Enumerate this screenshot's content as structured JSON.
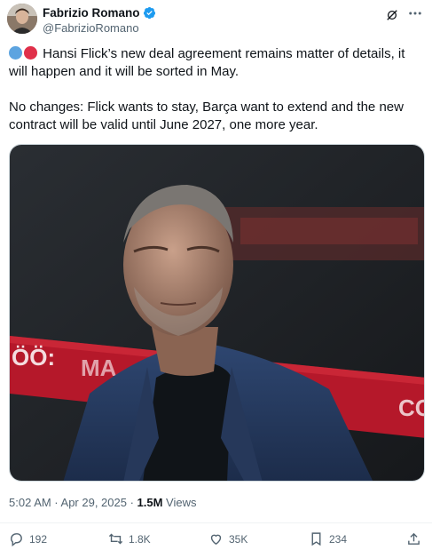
{
  "author": {
    "name": "Fabrizio Romano",
    "handle": "@FabrizioRomano"
  },
  "tweet": {
    "paragraph1": "Hansi Flick’s new deal agreement remains matter of details, it will happen and it will be sorted in May.",
    "paragraph2": "No changes: Flick wants to stay, Barça want to extend and the new contract will be valid until June 2027, one more year."
  },
  "media": {
    "banner_left": "ÖÖ:",
    "banner_mid": "MA",
    "banner_right": "CO"
  },
  "meta": {
    "timestamp": "5:02 AM · Apr 29, 2025 · ",
    "views_count": "1.5M",
    "views_label": " Views"
  },
  "actions": {
    "replies": "192",
    "reposts": "1.8K",
    "likes": "35K",
    "bookmarks": "234"
  },
  "colors": {
    "accent_verified": "#1d9bf0",
    "text_secondary": "#536471"
  }
}
